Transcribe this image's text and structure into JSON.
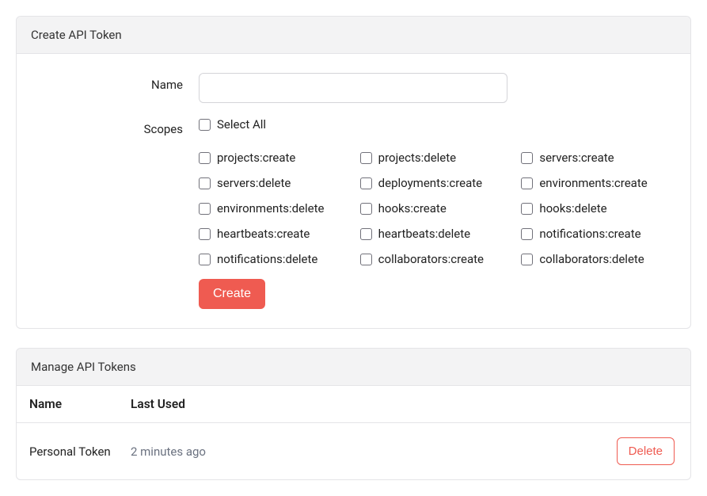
{
  "createCard": {
    "title": "Create API Token",
    "nameLabel": "Name",
    "nameValue": "",
    "scopesLabel": "Scopes",
    "selectAllLabel": "Select All",
    "scopes": [
      "projects:create",
      "projects:delete",
      "servers:create",
      "servers:delete",
      "deployments:create",
      "environments:create",
      "environments:delete",
      "hooks:create",
      "hooks:delete",
      "heartbeats:create",
      "heartbeats:delete",
      "notifications:create",
      "notifications:delete",
      "collaborators:create",
      "collaborators:delete"
    ],
    "createButton": "Create"
  },
  "manageCard": {
    "title": "Manage API Tokens",
    "columns": {
      "name": "Name",
      "lastUsed": "Last Used"
    },
    "tokens": [
      {
        "name": "Personal Token",
        "lastUsed": "2 minutes ago"
      }
    ],
    "deleteButton": "Delete"
  }
}
